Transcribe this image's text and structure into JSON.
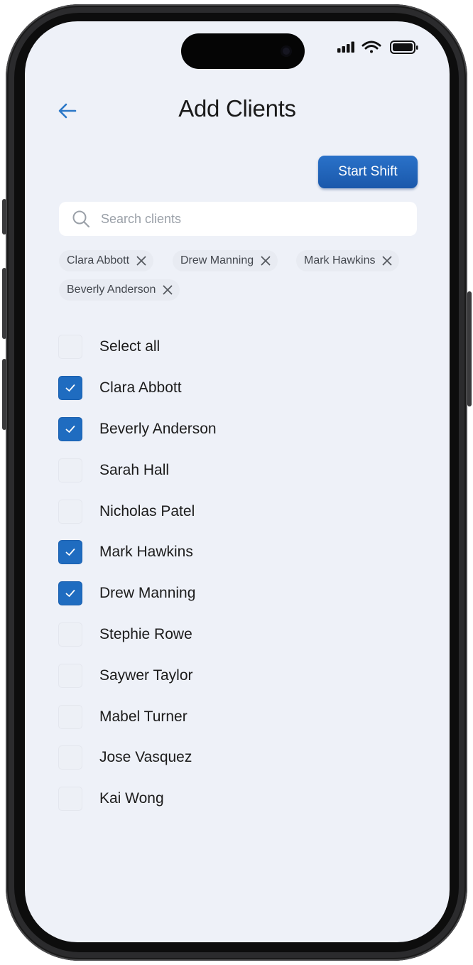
{
  "header": {
    "title": "Add Clients",
    "start_shift_label": "Start Shift"
  },
  "search": {
    "placeholder": "Search clients",
    "value": ""
  },
  "selected_chips": [
    {
      "label": "Clara Abbott"
    },
    {
      "label": "Drew Manning"
    },
    {
      "label": "Mark Hawkins"
    },
    {
      "label": "Beverly Anderson"
    }
  ],
  "select_all": {
    "label": "Select all",
    "checked": false
  },
  "clients": [
    {
      "name": "Clara Abbott",
      "checked": true
    },
    {
      "name": "Beverly Anderson",
      "checked": true
    },
    {
      "name": "Sarah Hall",
      "checked": false
    },
    {
      "name": "Nicholas Patel",
      "checked": false
    },
    {
      "name": "Mark Hawkins",
      "checked": true
    },
    {
      "name": "Drew Manning",
      "checked": true
    },
    {
      "name": "Stephie Rowe",
      "checked": false
    },
    {
      "name": "Saywer Taylor",
      "checked": false
    },
    {
      "name": "Mabel Turner",
      "checked": false
    },
    {
      "name": "Jose Vasquez",
      "checked": false
    },
    {
      "name": "Kai Wong",
      "checked": false
    }
  ],
  "colors": {
    "accent": "#1f6cc0",
    "screen_background": "#eef1f8",
    "back_arrow": "#2b78c8"
  },
  "icons": {
    "back": "arrow-left-icon",
    "search": "magnifier-icon",
    "chip_remove": "close-icon",
    "checkbox": "checkmark-icon",
    "status": [
      "cellular-signal-icon",
      "wifi-icon",
      "battery-icon"
    ]
  }
}
